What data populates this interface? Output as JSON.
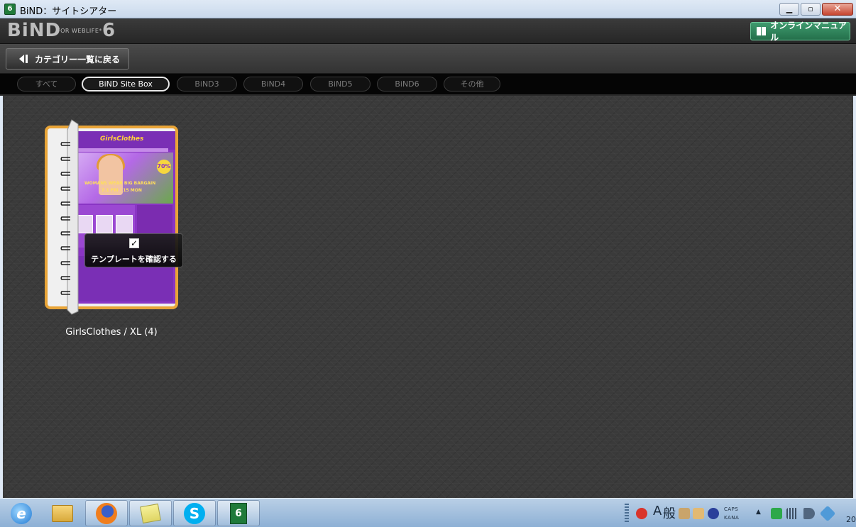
{
  "window": {
    "title": "BiND：サイトシアター",
    "app_icon_glyph": "6",
    "controls": {
      "minimize": "minimize-icon",
      "maximize": "maximize-icon",
      "close": "close-icon"
    }
  },
  "header": {
    "logo": "BiND",
    "logo_sub": "FOR WEBLIFE*",
    "logo_version": "6",
    "manual_button": "オンラインマニュアル",
    "manual_icon": "book-icon"
  },
  "backbar": {
    "back_button": "カテゴリー一覧に戻る",
    "back_icon": "back-arrow-icon"
  },
  "tabs": [
    {
      "label": "すべて",
      "active": false
    },
    {
      "label": "BiND Site Box",
      "active": true
    },
    {
      "label": "BiND3",
      "active": false
    },
    {
      "label": "BiND4",
      "active": false
    },
    {
      "label": "BiND5",
      "active": false
    },
    {
      "label": "BiND6",
      "active": false
    },
    {
      "label": "その他",
      "active": false
    }
  ],
  "template_card": {
    "caption": "GirlsClothes / XL (4)",
    "overlay_button": "テンプレートを確認する",
    "thumbnail": {
      "logo": "GirlsClothes",
      "badge": "70%",
      "headline_1": "WOMANS WEAR BIG BARGAIN",
      "headline_2": "7.1 FRI - 15 MON"
    }
  },
  "taskbar": {
    "apps": [
      {
        "icon": "ie-icon",
        "active": false
      },
      {
        "icon": "explorer-icon",
        "active": false
      },
      {
        "icon": "firefox-icon",
        "active": true
      },
      {
        "icon": "sticky-notes-icon",
        "active": true
      },
      {
        "icon": "skype-icon",
        "active": true
      },
      {
        "icon": "bind6-icon",
        "active": true
      }
    ],
    "ime_mode": "A",
    "ime_label": "般",
    "caps": "CAPS",
    "kana": "KANA",
    "clock": "20"
  },
  "colors": {
    "accent_orange": "#e8a437",
    "manual_green": "#2f8a5c",
    "thumbnail_purple": "#8a35c4"
  }
}
